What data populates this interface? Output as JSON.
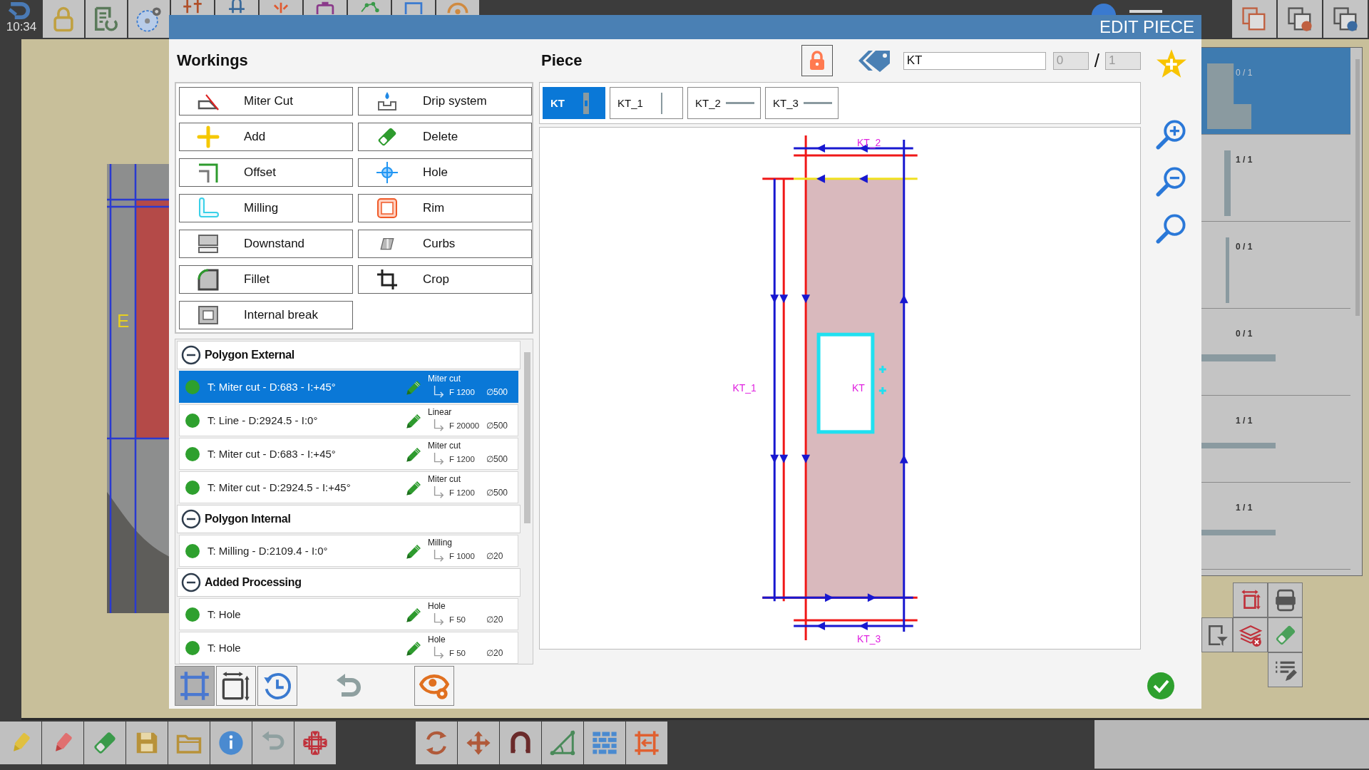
{
  "app": {
    "clock": "10:34"
  },
  "canvas": {
    "label": "E"
  },
  "pieces_panel": {
    "items": [
      {
        "count": "0 / 1",
        "selected": true,
        "kind": "l-shape"
      },
      {
        "count": "1 / 1",
        "selected": false,
        "kind": "vertical-thick"
      },
      {
        "count": "0 / 1",
        "selected": false,
        "kind": "vertical-thin"
      },
      {
        "count": "0 / 1",
        "selected": false,
        "kind": "horizontal-thick"
      },
      {
        "count": "1 / 1",
        "selected": false,
        "kind": "horizontal-thin"
      },
      {
        "count": "1 / 1",
        "selected": false,
        "kind": "horizontal-thin"
      }
    ]
  },
  "dialog": {
    "title": "EDIT PIECE",
    "workings": {
      "title": "Workings",
      "buttons": [
        {
          "label": "Miter Cut",
          "kind": "miter"
        },
        {
          "label": "Drip system",
          "kind": "drip"
        },
        {
          "label": "Add",
          "kind": "add"
        },
        {
          "label": "Delete",
          "kind": "delete"
        },
        {
          "label": "Offset",
          "kind": "offset"
        },
        {
          "label": "Hole",
          "kind": "hole"
        },
        {
          "label": "Milling",
          "kind": "milling"
        },
        {
          "label": "Rim",
          "kind": "rim"
        },
        {
          "label": "Downstand",
          "kind": "downstand"
        },
        {
          "label": "Curbs",
          "kind": "curbs"
        },
        {
          "label": "Fillet",
          "kind": "fillet"
        },
        {
          "label": "Crop",
          "kind": "crop"
        },
        {
          "label": "Internal break",
          "kind": "internal"
        }
      ]
    },
    "processing": {
      "groups": [
        {
          "title": "Polygon External",
          "expanded": true,
          "rows": [
            {
              "text": "T: Miter cut - D:683 - I:+45°",
              "selected": true,
              "tool": "Miter cut",
              "feed": "F 1200",
              "diameter": "∅500"
            },
            {
              "text": "T: Line - D:2924.5 - I:0°",
              "selected": false,
              "tool": "Linear",
              "feed": "F 20000",
              "diameter": "∅500"
            },
            {
              "text": "T: Miter cut - D:683 - I:+45°",
              "selected": false,
              "tool": "Miter cut",
              "feed": "F 1200",
              "diameter": "∅500"
            },
            {
              "text": "T: Miter cut - D:2924.5 - I:+45°",
              "selected": false,
              "tool": "Miter cut",
              "feed": "F 1200",
              "diameter": "∅500"
            }
          ]
        },
        {
          "title": "Polygon Internal",
          "expanded": true,
          "rows": [
            {
              "text": "T: Milling - D:2109.4 - I:0°",
              "selected": false,
              "tool": "Milling",
              "feed": "F 1000",
              "diameter": "∅20"
            }
          ]
        },
        {
          "title": "Added Processing",
          "expanded": true,
          "rows": [
            {
              "text": "T: Hole",
              "selected": false,
              "tool": "Hole",
              "feed": "F 50",
              "diameter": "∅20"
            },
            {
              "text": "T: Hole",
              "selected": false,
              "tool": "Hole",
              "feed": "F 50",
              "diameter": "∅20"
            }
          ]
        }
      ]
    },
    "piece": {
      "title": "Piece",
      "name": "KT",
      "count": "0",
      "separator": "/",
      "total": "1",
      "tabs": [
        {
          "label": "KT",
          "selected": true,
          "kind": "vertical-bar"
        },
        {
          "label": "KT_1",
          "selected": false,
          "kind": "vertical-line"
        },
        {
          "label": "KT_2",
          "selected": false,
          "kind": "horizontal-line"
        },
        {
          "label": "KT_3",
          "selected": false,
          "kind": "horizontal-line"
        }
      ],
      "drawing_labels": [
        {
          "text": "KT_2",
          "kind": "top"
        },
        {
          "text": "KT_1",
          "kind": "left"
        },
        {
          "text": "KT",
          "kind": "center"
        },
        {
          "text": "KT_3",
          "kind": "bottom"
        }
      ]
    }
  }
}
